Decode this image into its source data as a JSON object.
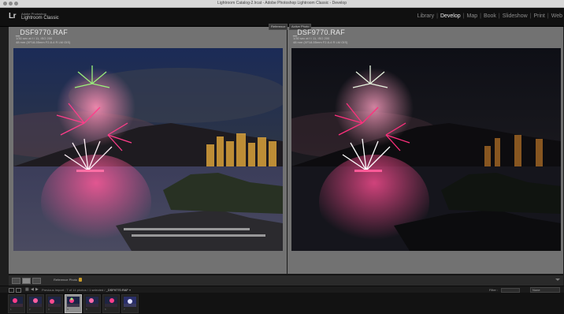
{
  "window": {
    "title": "Lightroom Catalog-2.lrcat - Adobe Photoshop Lightroom Classic - Develop"
  },
  "identity_plate": {
    "logo": "Lr",
    "line1": "Adobe Photoshop",
    "line2": "Lightroom Classic"
  },
  "modules": [
    {
      "label": "Library"
    },
    {
      "label": "Develop"
    },
    {
      "label": "Map"
    },
    {
      "label": "Book"
    },
    {
      "label": "Slideshow"
    },
    {
      "label": "Print"
    },
    {
      "label": "Web"
    }
  ],
  "active_module": "Develop",
  "left_pane": {
    "badge": "Reference",
    "filename": "_DSF9770.RAF",
    "info_line1": "1/30 sec at f / 11, ISO 200",
    "info_line2": "48 mm (XF18-55mm F2.8-4 R LM OIS)"
  },
  "right_pane": {
    "badge": "Active Photo",
    "filename": "_DSF9770.RAF",
    "info_line1": "1/30 sec at f / 11, ISO 200",
    "info_line2": "48 mm (XF18-55mm F2.8-4 R LM OIS)"
  },
  "toolbar": {
    "reference_label": "Reference Photo :",
    "view_buttons": [
      "loupe",
      "reference-view",
      "compare"
    ]
  },
  "filmstrip_header": {
    "source_prefix": "Previous Import",
    "source_count": "7 of 14 photos / 1 selected /",
    "source_file": "_DSF9770.RAF",
    "filter_label": "Filter :",
    "filter_value": "None"
  },
  "filmstrip": {
    "thumbs": [
      {
        "num": "1",
        "selected": false
      },
      {
        "num": "2",
        "selected": false
      },
      {
        "num": "3",
        "selected": false
      },
      {
        "num": "4",
        "selected": true
      },
      {
        "num": "5",
        "selected": false
      },
      {
        "num": "6",
        "selected": false
      },
      {
        "num": "7",
        "selected": false
      }
    ]
  },
  "colors": {
    "accent_active_text": "#f0f0f0",
    "workspace_gray": "#727272",
    "lock_icon": "#c89b2a"
  }
}
